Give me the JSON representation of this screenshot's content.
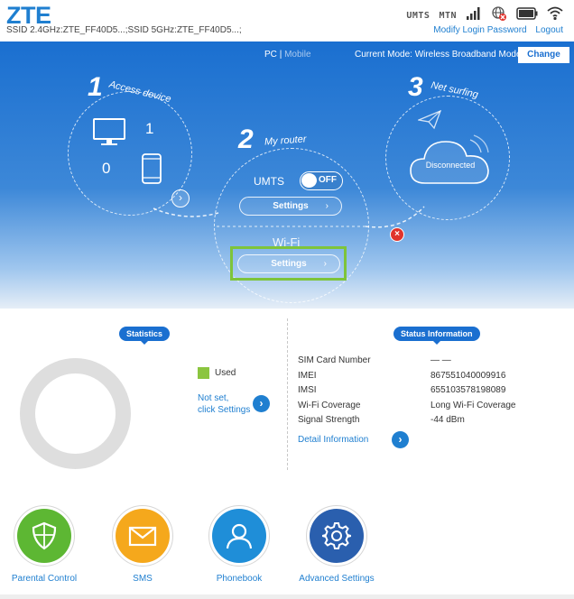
{
  "header": {
    "logo": "ZTE",
    "ssid": "SSID 2.4GHz:ZTE_FF40D5...;SSID 5GHz:ZTE_FF40D5...;",
    "network_type": "UMTS",
    "operator": "MTN",
    "links": {
      "modify_password": "Modify Login Password",
      "logout": "Logout"
    }
  },
  "mode_bar": {
    "pc": "PC",
    "separator": "|",
    "mobile": "Mobile",
    "current_mode": "Current Mode: Wireless Broadband Mode",
    "change_label": "Change"
  },
  "hero": {
    "step1": {
      "num": "1",
      "label": "Access device",
      "wired_count": "1",
      "wireless_count": "0"
    },
    "step2": {
      "num": "2",
      "label": "My router",
      "umts_label": "UMTS",
      "toggle_state": "OFF",
      "settings_label": "Settings",
      "wifi_label": "Wi-Fi",
      "wifi_settings_label": "Settings"
    },
    "step3": {
      "num": "3",
      "label": "Net surfing",
      "status": "Disconnected"
    },
    "chevron": "›",
    "disconnect_mark": "×"
  },
  "statistics": {
    "title": "Statistics",
    "legend_used": "Used",
    "notset_line1": "Not set,",
    "notset_line2": "click Settings",
    "used_fraction": 0
  },
  "status_info": {
    "title": "Status Information",
    "rows": [
      {
        "label": "SIM Card Number",
        "value": "— —"
      },
      {
        "label": "IMEI",
        "value": "867551040009916"
      },
      {
        "label": "IMSI",
        "value": "655103578198089"
      },
      {
        "label": "Wi-Fi Coverage",
        "value": "Long Wi-Fi Coverage"
      },
      {
        "label": "Signal Strength",
        "value": "-44 dBm"
      }
    ],
    "detail_link": "Detail Information"
  },
  "shortcuts": [
    {
      "label": "Parental Control",
      "icon": "shield-icon",
      "color": "#5db733"
    },
    {
      "label": "SMS",
      "icon": "envelope-icon",
      "color": "#f5a81c"
    },
    {
      "label": "Phonebook",
      "icon": "person-icon",
      "color": "#1f8ed8"
    },
    {
      "label": "Advanced Settings",
      "icon": "gear-icon",
      "color": "#2a5fae"
    }
  ]
}
